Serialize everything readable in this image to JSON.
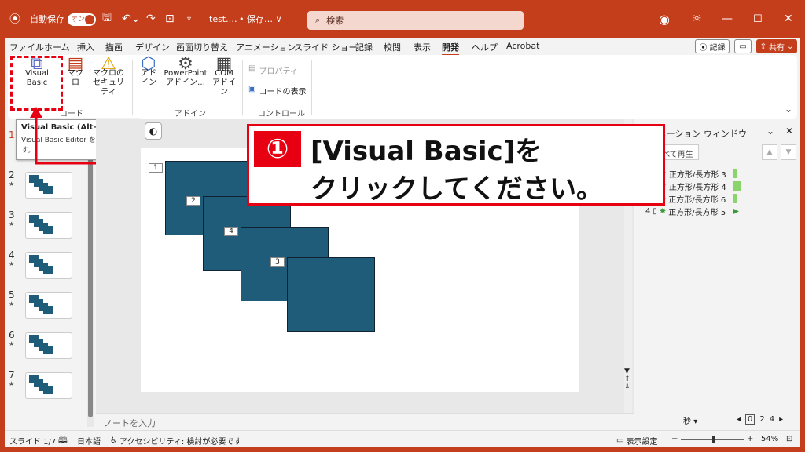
{
  "titlebar": {
    "autosave_label": "自動保存",
    "autosave_state": "オン",
    "filename": "test.…",
    "save_status": "• 保存… ∨",
    "search_placeholder": "検索"
  },
  "tabs": [
    "ファイル",
    "ホーム",
    "挿入",
    "描画",
    "デザイン",
    "画面切り替え",
    "アニメーション",
    "スライド ショー",
    "記録",
    "校閲",
    "表示",
    "開発",
    "ヘルプ",
    "Acrobat"
  ],
  "active_tab": "開発",
  "tab_actions": {
    "record": "記録",
    "share": "共有"
  },
  "ribbon": {
    "visual_basic": "Visual Basic",
    "macro": "マクロ",
    "macro_security_1": "マクロの",
    "macro_security_2": "セキュリティ",
    "group_code": "コード",
    "addin_1": "アド",
    "addin_2": "イン",
    "ppt_addin_1": "PowerPoint",
    "ppt_addin_2": "アドイン…",
    "com_addin_1": "COM",
    "com_addin_2": "アドイン",
    "group_addin": "アドイン",
    "properties": "プロパティ",
    "view_code": "コードの表示",
    "group_controls": "コントロール"
  },
  "tooltip": {
    "title": "Visual Basic (Alt+F11)",
    "body_1": "Visual Basic Editor を起動しま",
    "body_2": "す。"
  },
  "thumbnails": [
    {
      "num": "1"
    },
    {
      "num": "2"
    },
    {
      "num": "3"
    },
    {
      "num": "4"
    },
    {
      "num": "5"
    },
    {
      "num": "6"
    },
    {
      "num": "7"
    }
  ],
  "slide_tags": [
    "1",
    "2",
    "4",
    "3"
  ],
  "notes_placeholder": "ノートを入力",
  "anim_pane": {
    "title": "アニメーション ウィンドウ",
    "play_label": "すべて再生",
    "items": [
      {
        "num": "1",
        "label": "正方形/長方形 3"
      },
      {
        "num": "2",
        "label": "正方形/長方形 4"
      },
      {
        "num": "3",
        "label": "正方形/長方形 6"
      },
      {
        "num": "4",
        "label": "正方形/長方形 5"
      }
    ],
    "seconds_label": "秒",
    "timeline": [
      "0",
      "2",
      "4"
    ]
  },
  "status": {
    "slide": "スライド 1/7",
    "language": "日本語",
    "accessibility": "アクセシビリティ: 検討が必要です",
    "display_settings": "表示設定",
    "zoom": "54%"
  },
  "callout": {
    "number": "①",
    "line1": "[Visual Basic]を",
    "line2": "クリックしてください。"
  },
  "colors": {
    "brand": "#c43e1c",
    "highlight": "#e60012",
    "shape": "#1f5c7a"
  }
}
